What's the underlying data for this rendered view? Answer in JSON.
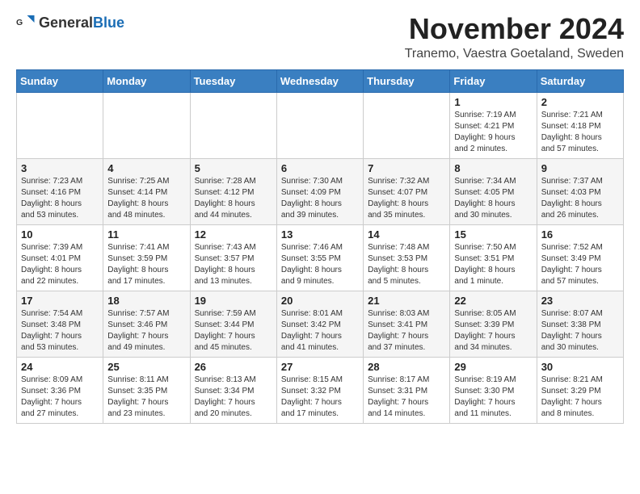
{
  "logo": {
    "text_general": "General",
    "text_blue": "Blue"
  },
  "header": {
    "title": "November 2024",
    "subtitle": "Tranemo, Vaestra Goetaland, Sweden"
  },
  "weekdays": [
    "Sunday",
    "Monday",
    "Tuesday",
    "Wednesday",
    "Thursday",
    "Friday",
    "Saturday"
  ],
  "weeks": [
    [
      {
        "day": "",
        "info": ""
      },
      {
        "day": "",
        "info": ""
      },
      {
        "day": "",
        "info": ""
      },
      {
        "day": "",
        "info": ""
      },
      {
        "day": "",
        "info": ""
      },
      {
        "day": "1",
        "info": "Sunrise: 7:19 AM\nSunset: 4:21 PM\nDaylight: 9 hours\nand 2 minutes."
      },
      {
        "day": "2",
        "info": "Sunrise: 7:21 AM\nSunset: 4:18 PM\nDaylight: 8 hours\nand 57 minutes."
      }
    ],
    [
      {
        "day": "3",
        "info": "Sunrise: 7:23 AM\nSunset: 4:16 PM\nDaylight: 8 hours\nand 53 minutes."
      },
      {
        "day": "4",
        "info": "Sunrise: 7:25 AM\nSunset: 4:14 PM\nDaylight: 8 hours\nand 48 minutes."
      },
      {
        "day": "5",
        "info": "Sunrise: 7:28 AM\nSunset: 4:12 PM\nDaylight: 8 hours\nand 44 minutes."
      },
      {
        "day": "6",
        "info": "Sunrise: 7:30 AM\nSunset: 4:09 PM\nDaylight: 8 hours\nand 39 minutes."
      },
      {
        "day": "7",
        "info": "Sunrise: 7:32 AM\nSunset: 4:07 PM\nDaylight: 8 hours\nand 35 minutes."
      },
      {
        "day": "8",
        "info": "Sunrise: 7:34 AM\nSunset: 4:05 PM\nDaylight: 8 hours\nand 30 minutes."
      },
      {
        "day": "9",
        "info": "Sunrise: 7:37 AM\nSunset: 4:03 PM\nDaylight: 8 hours\nand 26 minutes."
      }
    ],
    [
      {
        "day": "10",
        "info": "Sunrise: 7:39 AM\nSunset: 4:01 PM\nDaylight: 8 hours\nand 22 minutes."
      },
      {
        "day": "11",
        "info": "Sunrise: 7:41 AM\nSunset: 3:59 PM\nDaylight: 8 hours\nand 17 minutes."
      },
      {
        "day": "12",
        "info": "Sunrise: 7:43 AM\nSunset: 3:57 PM\nDaylight: 8 hours\nand 13 minutes."
      },
      {
        "day": "13",
        "info": "Sunrise: 7:46 AM\nSunset: 3:55 PM\nDaylight: 8 hours\nand 9 minutes."
      },
      {
        "day": "14",
        "info": "Sunrise: 7:48 AM\nSunset: 3:53 PM\nDaylight: 8 hours\nand 5 minutes."
      },
      {
        "day": "15",
        "info": "Sunrise: 7:50 AM\nSunset: 3:51 PM\nDaylight: 8 hours\nand 1 minute."
      },
      {
        "day": "16",
        "info": "Sunrise: 7:52 AM\nSunset: 3:49 PM\nDaylight: 7 hours\nand 57 minutes."
      }
    ],
    [
      {
        "day": "17",
        "info": "Sunrise: 7:54 AM\nSunset: 3:48 PM\nDaylight: 7 hours\nand 53 minutes."
      },
      {
        "day": "18",
        "info": "Sunrise: 7:57 AM\nSunset: 3:46 PM\nDaylight: 7 hours\nand 49 minutes."
      },
      {
        "day": "19",
        "info": "Sunrise: 7:59 AM\nSunset: 3:44 PM\nDaylight: 7 hours\nand 45 minutes."
      },
      {
        "day": "20",
        "info": "Sunrise: 8:01 AM\nSunset: 3:42 PM\nDaylight: 7 hours\nand 41 minutes."
      },
      {
        "day": "21",
        "info": "Sunrise: 8:03 AM\nSunset: 3:41 PM\nDaylight: 7 hours\nand 37 minutes."
      },
      {
        "day": "22",
        "info": "Sunrise: 8:05 AM\nSunset: 3:39 PM\nDaylight: 7 hours\nand 34 minutes."
      },
      {
        "day": "23",
        "info": "Sunrise: 8:07 AM\nSunset: 3:38 PM\nDaylight: 7 hours\nand 30 minutes."
      }
    ],
    [
      {
        "day": "24",
        "info": "Sunrise: 8:09 AM\nSunset: 3:36 PM\nDaylight: 7 hours\nand 27 minutes."
      },
      {
        "day": "25",
        "info": "Sunrise: 8:11 AM\nSunset: 3:35 PM\nDaylight: 7 hours\nand 23 minutes."
      },
      {
        "day": "26",
        "info": "Sunrise: 8:13 AM\nSunset: 3:34 PM\nDaylight: 7 hours\nand 20 minutes."
      },
      {
        "day": "27",
        "info": "Sunrise: 8:15 AM\nSunset: 3:32 PM\nDaylight: 7 hours\nand 17 minutes."
      },
      {
        "day": "28",
        "info": "Sunrise: 8:17 AM\nSunset: 3:31 PM\nDaylight: 7 hours\nand 14 minutes."
      },
      {
        "day": "29",
        "info": "Sunrise: 8:19 AM\nSunset: 3:30 PM\nDaylight: 7 hours\nand 11 minutes."
      },
      {
        "day": "30",
        "info": "Sunrise: 8:21 AM\nSunset: 3:29 PM\nDaylight: 7 hours\nand 8 minutes."
      }
    ]
  ]
}
